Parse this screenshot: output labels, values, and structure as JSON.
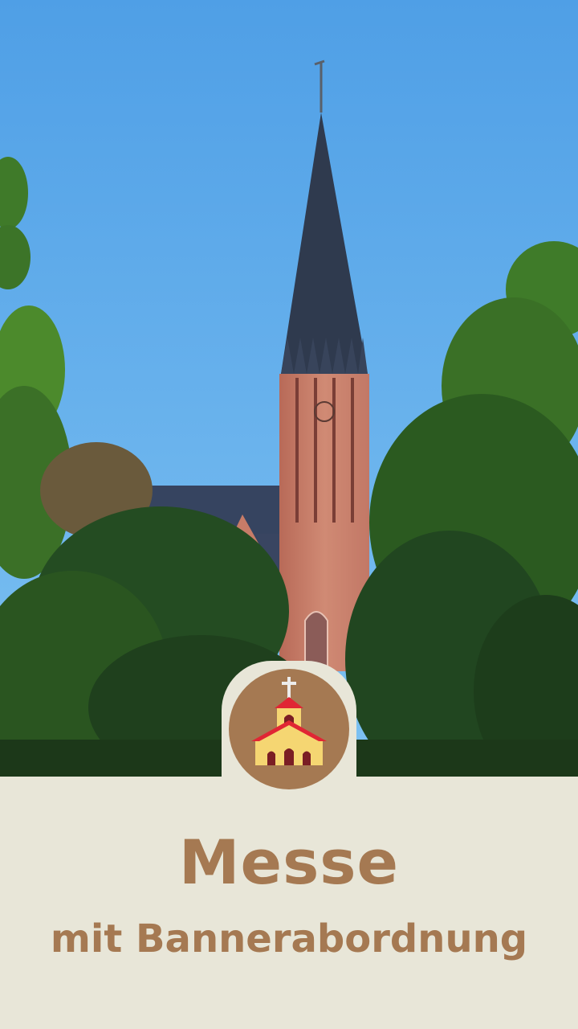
{
  "title": "Messe",
  "subtitle": "mit Bannerabordnung",
  "colors": {
    "accent": "#a57952",
    "panel": "#e8e6d8",
    "sky": "#5aa8ea",
    "brick": "#c87a68",
    "roof": "#2f3a4e",
    "church_wall": "#f5d672",
    "church_roof": "#e02634"
  },
  "icons": {
    "badge": "church-icon",
    "photo": "church-tower-photo"
  }
}
